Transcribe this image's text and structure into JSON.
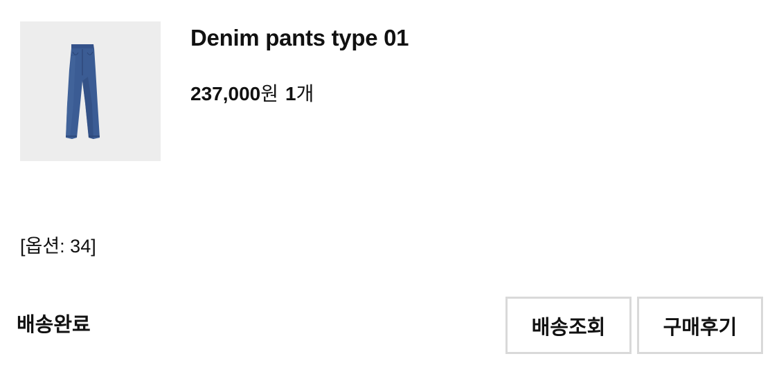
{
  "product": {
    "image_icon": "jeans-icon",
    "image_background": "#ededed",
    "jeans_color": "#3a5a8f",
    "name": "Denim pants type 01",
    "price_amount": "237,000",
    "price_unit": "원",
    "quantity_amount": "1",
    "quantity_unit": "개"
  },
  "option_label": "[옵션: 34]",
  "status": "배송완료",
  "buttons": {
    "track_label": "배송조회",
    "review_label": "구매후기"
  }
}
